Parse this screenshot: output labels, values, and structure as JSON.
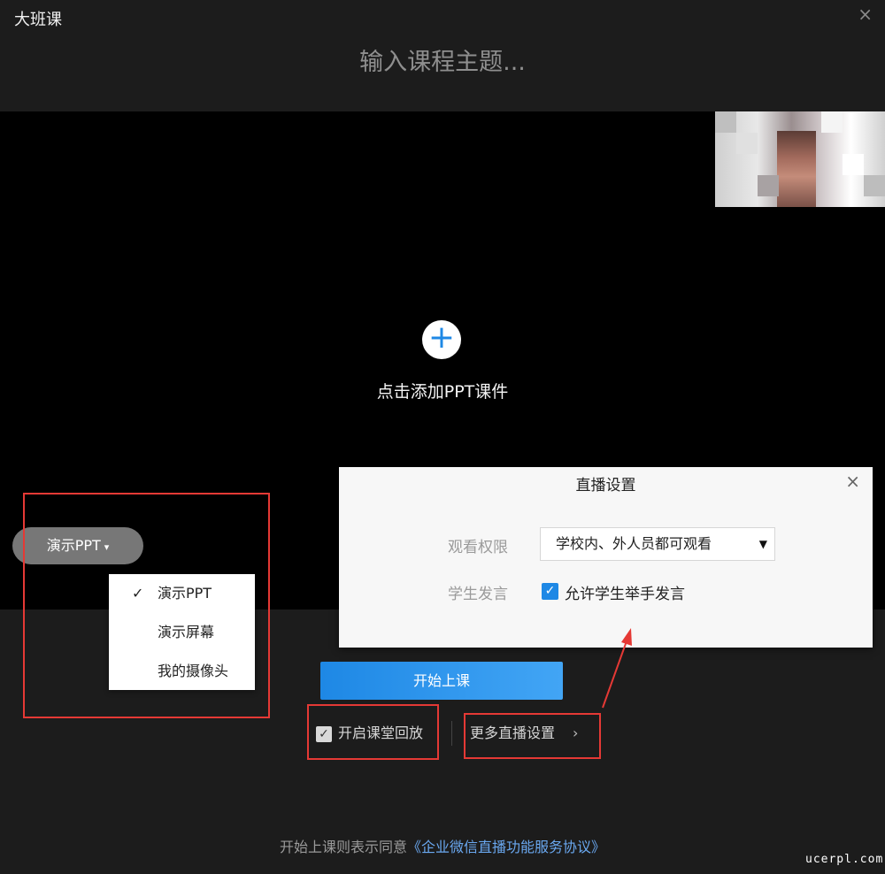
{
  "window": {
    "title": "大班课",
    "close_glyph": "×"
  },
  "course": {
    "title_placeholder": "输入课程主题..."
  },
  "stage": {
    "add_glyph": "+",
    "add_label": "点击添加PPT课件"
  },
  "mode": {
    "button_label": "演示PPT",
    "button_arrow": "▾",
    "menu": [
      {
        "label": "演示PPT",
        "checked": true
      },
      {
        "label": "演示屏幕",
        "checked": false
      },
      {
        "label": "我的摄像头",
        "checked": false
      }
    ],
    "check_glyph": "✓"
  },
  "live_settings": {
    "title": "直播设置",
    "close_glyph": "×",
    "view_permission_label": "观看权限",
    "view_permission_value": "学校内、外人员都可观看",
    "select_arrow": "▼",
    "student_speech_label": "学生发言",
    "allow_raise_hand_label": "允许学生举手发言",
    "allow_raise_hand_checked": true,
    "check_glyph": "✓"
  },
  "actions": {
    "start_label": "开始上课",
    "replay_label": "开启课堂回放",
    "replay_checked": true,
    "replay_check_glyph": "✓",
    "more_settings_label": "更多直播设置",
    "more_chevron": "›"
  },
  "footer": {
    "agree_prefix": "开始上课则表示同意",
    "agree_link": "《企业微信直播功能服务协议》"
  },
  "watermark": "ucerpl.com",
  "colors": {
    "accent": "#1e88e5",
    "annotation_red": "#e53935",
    "background": "#1c1c1c",
    "stage": "#000000"
  },
  "icons": {
    "add": "plus-icon",
    "close": "close-icon",
    "check": "check-icon",
    "chevron": "chevron-right-icon",
    "dropdown": "caret-down-icon"
  }
}
